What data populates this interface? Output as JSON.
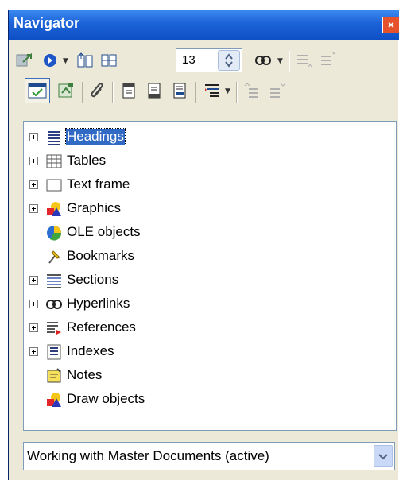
{
  "window": {
    "title": "Navigator",
    "close_glyph": "×"
  },
  "toolbar": {
    "row1": [
      "navigation-icon",
      "previous-object-icon",
      "dropdown-arrow",
      "previous-icon",
      "next-icon",
      "drag-mode-icon",
      "dropdown-arrow",
      "promote-level-icon",
      "demote-level-icon"
    ],
    "row2": [
      "content-view-toggle-icon",
      "set-reminder-icon",
      "paperclip-icon",
      "header-icon",
      "footer-icon",
      "anchor-icon",
      "heading-levels-icon",
      "dropdown-arrow",
      "promote-chapter-icon",
      "demote-chapter-icon"
    ],
    "spin_value": "13"
  },
  "tree": {
    "items": [
      {
        "label": "Headings",
        "icon": "headings-icon",
        "expandable": true,
        "selected": true
      },
      {
        "label": "Tables",
        "icon": "tables-icon",
        "expandable": true,
        "selected": false
      },
      {
        "label": "Text frame",
        "icon": "text-frame-icon",
        "expandable": true,
        "selected": false
      },
      {
        "label": "Graphics",
        "icon": "graphics-icon",
        "expandable": true,
        "selected": false
      },
      {
        "label": "OLE objects",
        "icon": "ole-objects-icon",
        "expandable": false,
        "selected": false
      },
      {
        "label": "Bookmarks",
        "icon": "bookmarks-icon",
        "expandable": false,
        "selected": false
      },
      {
        "label": "Sections",
        "icon": "sections-icon",
        "expandable": true,
        "selected": false
      },
      {
        "label": "Hyperlinks",
        "icon": "hyperlinks-icon",
        "expandable": true,
        "selected": false
      },
      {
        "label": "References",
        "icon": "references-icon",
        "expandable": true,
        "selected": false
      },
      {
        "label": "Indexes",
        "icon": "indexes-icon",
        "expandable": true,
        "selected": false
      },
      {
        "label": "Notes",
        "icon": "notes-icon",
        "expandable": false,
        "selected": false
      },
      {
        "label": "Draw objects",
        "icon": "draw-objects-icon",
        "expandable": false,
        "selected": false
      }
    ]
  },
  "document_select": {
    "value": "Working with Master Documents (active)"
  },
  "colors": {
    "titlebar": "#0F4FC6",
    "selection": "#316AC5",
    "window_bg": "#ECE9D8",
    "close_button": "#E5522B"
  }
}
